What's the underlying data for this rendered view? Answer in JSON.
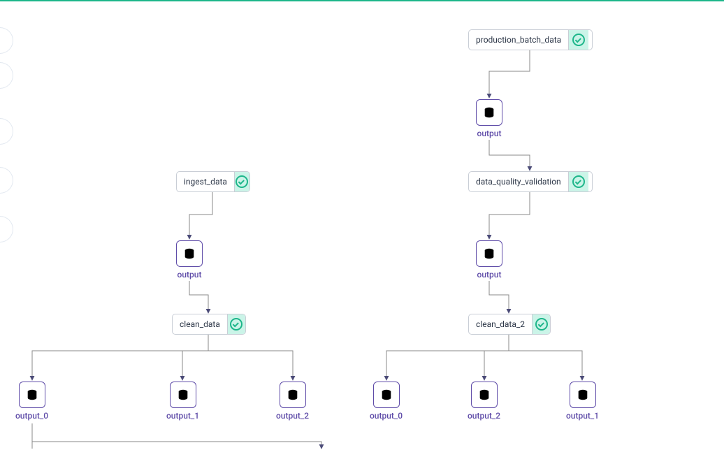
{
  "nodes": {
    "production_batch_data": "production_batch_data",
    "data_quality_validation": "data_quality_validation",
    "ingest_data": "ingest_data",
    "clean_data": "clean_data",
    "clean_data_2": "clean_data_2"
  },
  "artifacts": {
    "output": "output",
    "output_0": "output_0",
    "output_1": "output_1",
    "output_2": "output_2"
  }
}
